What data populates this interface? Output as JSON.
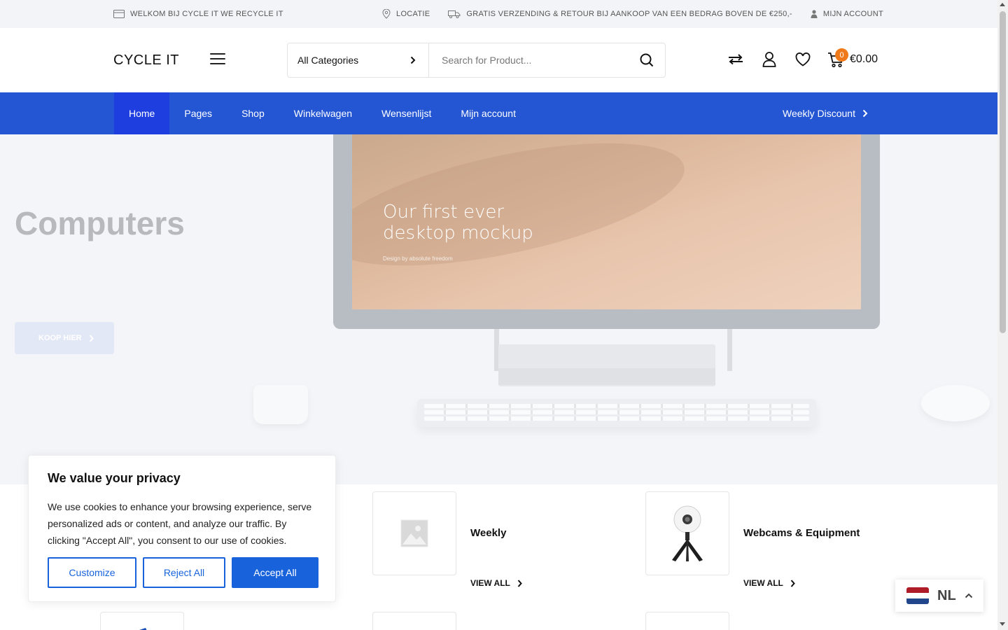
{
  "topbar": {
    "welcome": "WELKOM BIJ CYCLE IT WE RECYCLE IT",
    "location": "LOCATIE",
    "shipping": "GRATIS VERZENDING & RETOUR BIJ AANKOOP VAN EEN BEDRAG BOVEN DE €250,-",
    "account": "MIJN ACCOUNT"
  },
  "header": {
    "logo": "CYCLE IT",
    "category_select": "All Categories",
    "search_placeholder": "Search for Product...",
    "cart_count": "0",
    "cart_total": "€0.00"
  },
  "nav": {
    "items": [
      {
        "label": "Home",
        "active": true
      },
      {
        "label": "Pages"
      },
      {
        "label": "Shop"
      },
      {
        "label": "Winkelwagen"
      },
      {
        "label": "Wensenlijst"
      },
      {
        "label": "Mijn account"
      }
    ],
    "weekly_discount": "Weekly Discount"
  },
  "hero": {
    "title": "Computers",
    "button": "KOOP HIER",
    "screen_heading_1": "Our first ever",
    "screen_heading_2": "desktop mockup",
    "screen_subtext": "Design by absolute freedom"
  },
  "categories": [
    {
      "name": "Weekly",
      "view_all": "VIEW ALL",
      "image": "placeholder-icon"
    },
    {
      "name": "Webcams & Equipment",
      "view_all": "VIEW ALL",
      "image": "webcam-tripod-image"
    }
  ],
  "cookie": {
    "title": "We value your privacy",
    "text": "We use cookies to enhance your browsing experience, serve personalized ads or content, and analyze our traffic. By clicking \"Accept All\", you consent to our use of cookies.",
    "customize": "Customize",
    "reject": "Reject All",
    "accept": "Accept All"
  },
  "language": {
    "code": "NL"
  },
  "colors": {
    "nav_bg": "#2456d4",
    "nav_active": "#1e3ee0",
    "cart_badge": "#f07a1a",
    "cookie_primary": "#1863dc"
  }
}
